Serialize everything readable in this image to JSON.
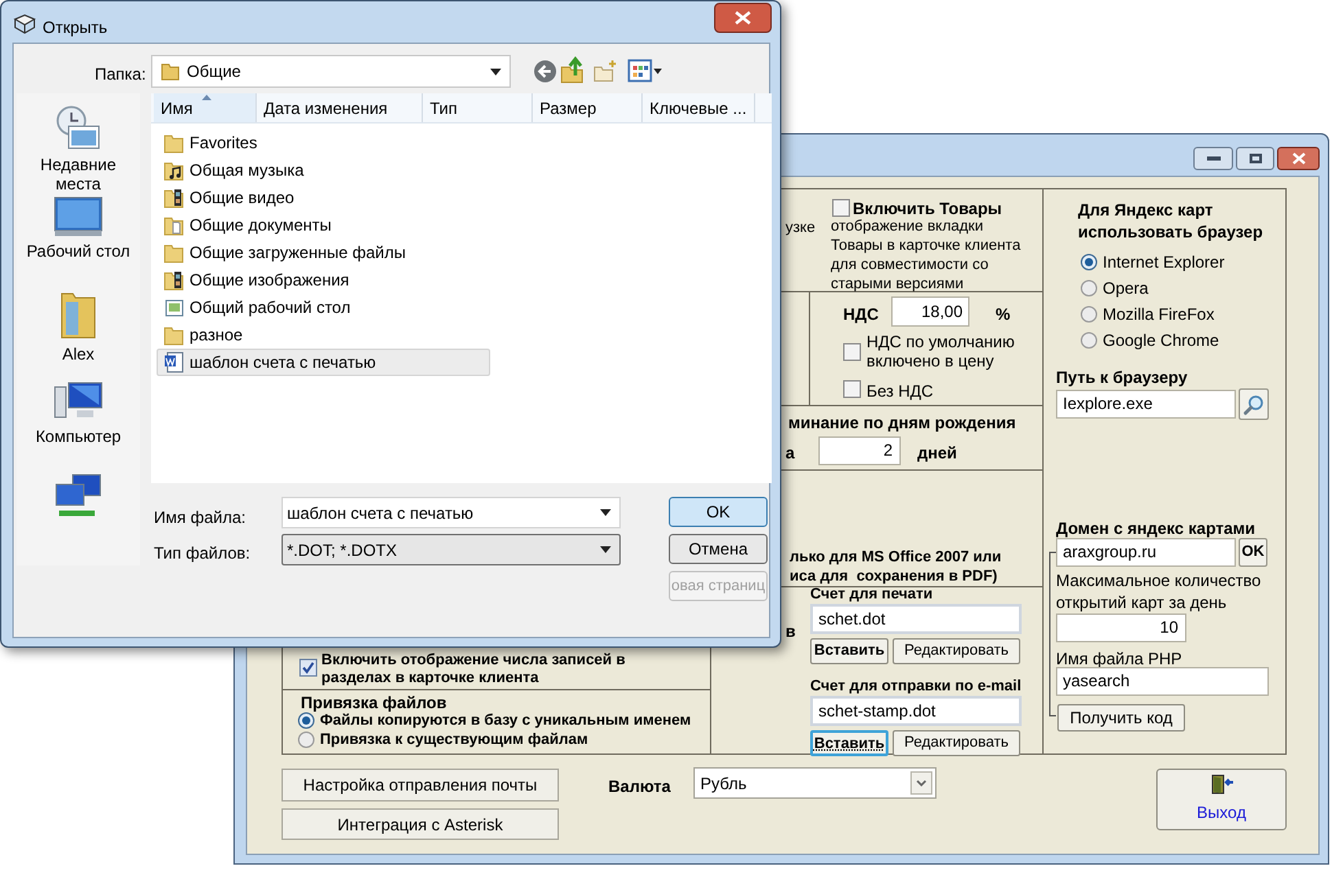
{
  "open_dialog": {
    "title": "Открыть",
    "folder_label": "Папка:",
    "folder": "Общие",
    "places": [
      {
        "label": "Недавние места",
        "kind": "recent"
      },
      {
        "label": "Рабочий стол",
        "kind": "desktop"
      },
      {
        "label": "Alex",
        "kind": "user"
      },
      {
        "label": "Компьютер",
        "kind": "computer"
      },
      {
        "kind": "network"
      }
    ],
    "columns": [
      {
        "label": "Имя",
        "sorted": true
      },
      {
        "label": "Дата изменения",
        "sorted": false
      },
      {
        "label": "Тип",
        "sorted": false
      },
      {
        "label": "Размер",
        "sorted": false
      },
      {
        "label": "Ключевые ...",
        "sorted": false
      }
    ],
    "files": [
      {
        "name": "Favorites",
        "kind": "folder",
        "selected": false
      },
      {
        "name": "Общая музыка",
        "kind": "music",
        "selected": false
      },
      {
        "name": "Общие видео",
        "kind": "video",
        "selected": false
      },
      {
        "name": "Общие документы",
        "kind": "documents",
        "selected": false
      },
      {
        "name": "Общие загруженные файлы",
        "kind": "folder",
        "selected": false
      },
      {
        "name": "Общие изображения",
        "kind": "video",
        "selected": false
      },
      {
        "name": "Общий рабочий стол",
        "kind": "desktop",
        "selected": false
      },
      {
        "name": "разное",
        "kind": "folder",
        "selected": false
      },
      {
        "name": "шаблон счета с печатью",
        "kind": "word",
        "selected": true
      }
    ],
    "file_name_label": "Имя файла:",
    "file_name": "шаблон счета с печатью",
    "file_type_label": "Тип файлов:",
    "file_type": "*.DOT; *.DOTX",
    "buttons": [
      {
        "label": "OK",
        "kind": "default",
        "disabled": false
      },
      {
        "label": "Отмена",
        "kind": "normal",
        "disabled": false
      },
      {
        "label": "овая страниц",
        "kind": "normal",
        "disabled": true
      }
    ]
  },
  "settings_window": {
    "fragment_upload": "узке",
    "goods": {
      "label": "Включить Товары",
      "checked": false,
      "description": "отображение вкладки Товары в карточке клиента для совместимости со старыми версиями"
    },
    "vat": {
      "label": "НДС",
      "value": "18,00",
      "unit": "%",
      "options": [
        {
          "label": "НДС по умолчанию включено в цену",
          "checked": false
        },
        {
          "label": "Без НДС",
          "checked": false
        }
      ]
    },
    "birthday": {
      "title": "минание по дням рождения",
      "prefix": "а",
      "days": "2",
      "unit": "дней"
    },
    "office_note": [
      "лько для MS Office 2007 или",
      "иса для  сохранения в PDF)"
    ],
    "fragment_templates": "в",
    "templates": [
      {
        "label": "Счет для печати",
        "file": "schet.dot",
        "insert": "Вставить",
        "insert_focused": false,
        "edit": "Редактировать"
      },
      {
        "label": "Счет для отправки по e-mail",
        "file": "schet-stamp.dot",
        "insert": "Вставить",
        "insert_focused": true,
        "edit": "Редактировать"
      }
    ],
    "record_count": {
      "label": "Включить отображение числа записей в разделах в карточке клиента",
      "checked": true
    },
    "file_binding": {
      "title": "Привязка файлов",
      "options": [
        {
          "label": "Файлы копируются в базу с уникальным именем",
          "selected": true
        },
        {
          "label": "Привязка к существующим файлам",
          "selected": false
        }
      ]
    },
    "maps": {
      "title": "Для Яндекс карт использовать браузер",
      "browsers": [
        {
          "label": "Internet Explorer",
          "selected": true
        },
        {
          "label": "Opera",
          "selected": false
        },
        {
          "label": "Mozilla FireFox",
          "selected": false
        },
        {
          "label": "Google Chrome",
          "selected": false
        }
      ],
      "path_label": "Путь к браузеру",
      "path": "Iexplore.exe",
      "domain_label": "Домен с яндекс картами",
      "domain": "araxgroup.ru",
      "domain_button": "OK",
      "max_label": "Максимальное количество открытий карт за день",
      "max_value": "10",
      "php_label": "Имя файла PHP",
      "php_value": "yasearch",
      "get_code": "Получить код"
    },
    "mail_button": "Настройка отправления почты",
    "asterisk_button": "Интеграция с Asterisk",
    "currency_label": "Валюта",
    "currency": "Рубль",
    "exit": "Выход"
  }
}
